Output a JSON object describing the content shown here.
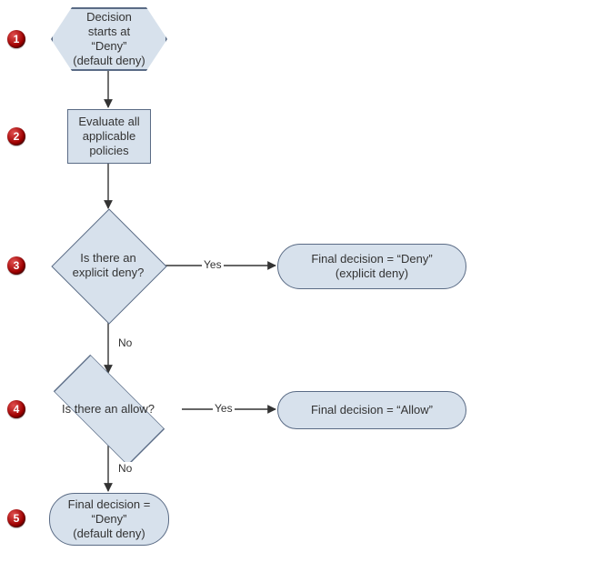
{
  "badges": {
    "b1": "1",
    "b2": "2",
    "b3": "3",
    "b4": "4",
    "b5": "5"
  },
  "steps": {
    "start_hex": "Decision\nstarts at\n“Deny”\n(default deny)",
    "evaluate_rect": "Evaluate all\napplicable\npolicies",
    "explicit_deny_q": "Is there an\nexplicit deny?",
    "allow_q": "Is there an allow?",
    "final_explicit_deny": "Final decision = “Deny”\n(explicit deny)",
    "final_allow": "Final decision = “Allow”",
    "final_default_deny": "Final decision =\n“Deny”\n(default deny)"
  },
  "edges": {
    "yes": "Yes",
    "no": "No"
  },
  "chart_data": {
    "type": "flowchart",
    "title": "Policy evaluation decision flow",
    "nodes": [
      {
        "id": "n1",
        "step": 1,
        "shape": "hexagon",
        "label": "Decision starts at “Deny” (default deny)"
      },
      {
        "id": "n2",
        "step": 2,
        "shape": "rectangle",
        "label": "Evaluate all applicable policies"
      },
      {
        "id": "n3",
        "step": 3,
        "shape": "diamond",
        "label": "Is there an explicit deny?"
      },
      {
        "id": "n3y",
        "step": 3,
        "shape": "terminator",
        "label": "Final decision = “Deny” (explicit deny)"
      },
      {
        "id": "n4",
        "step": 4,
        "shape": "diamond",
        "label": "Is there an allow?"
      },
      {
        "id": "n4y",
        "step": 4,
        "shape": "terminator",
        "label": "Final decision = “Allow”"
      },
      {
        "id": "n5",
        "step": 5,
        "shape": "terminator",
        "label": "Final decision = “Deny” (default deny)"
      }
    ],
    "edges": [
      {
        "from": "n1",
        "to": "n2",
        "label": ""
      },
      {
        "from": "n2",
        "to": "n3",
        "label": ""
      },
      {
        "from": "n3",
        "to": "n3y",
        "label": "Yes"
      },
      {
        "from": "n3",
        "to": "n4",
        "label": "No"
      },
      {
        "from": "n4",
        "to": "n4y",
        "label": "Yes"
      },
      {
        "from": "n4",
        "to": "n5",
        "label": "No"
      }
    ]
  }
}
